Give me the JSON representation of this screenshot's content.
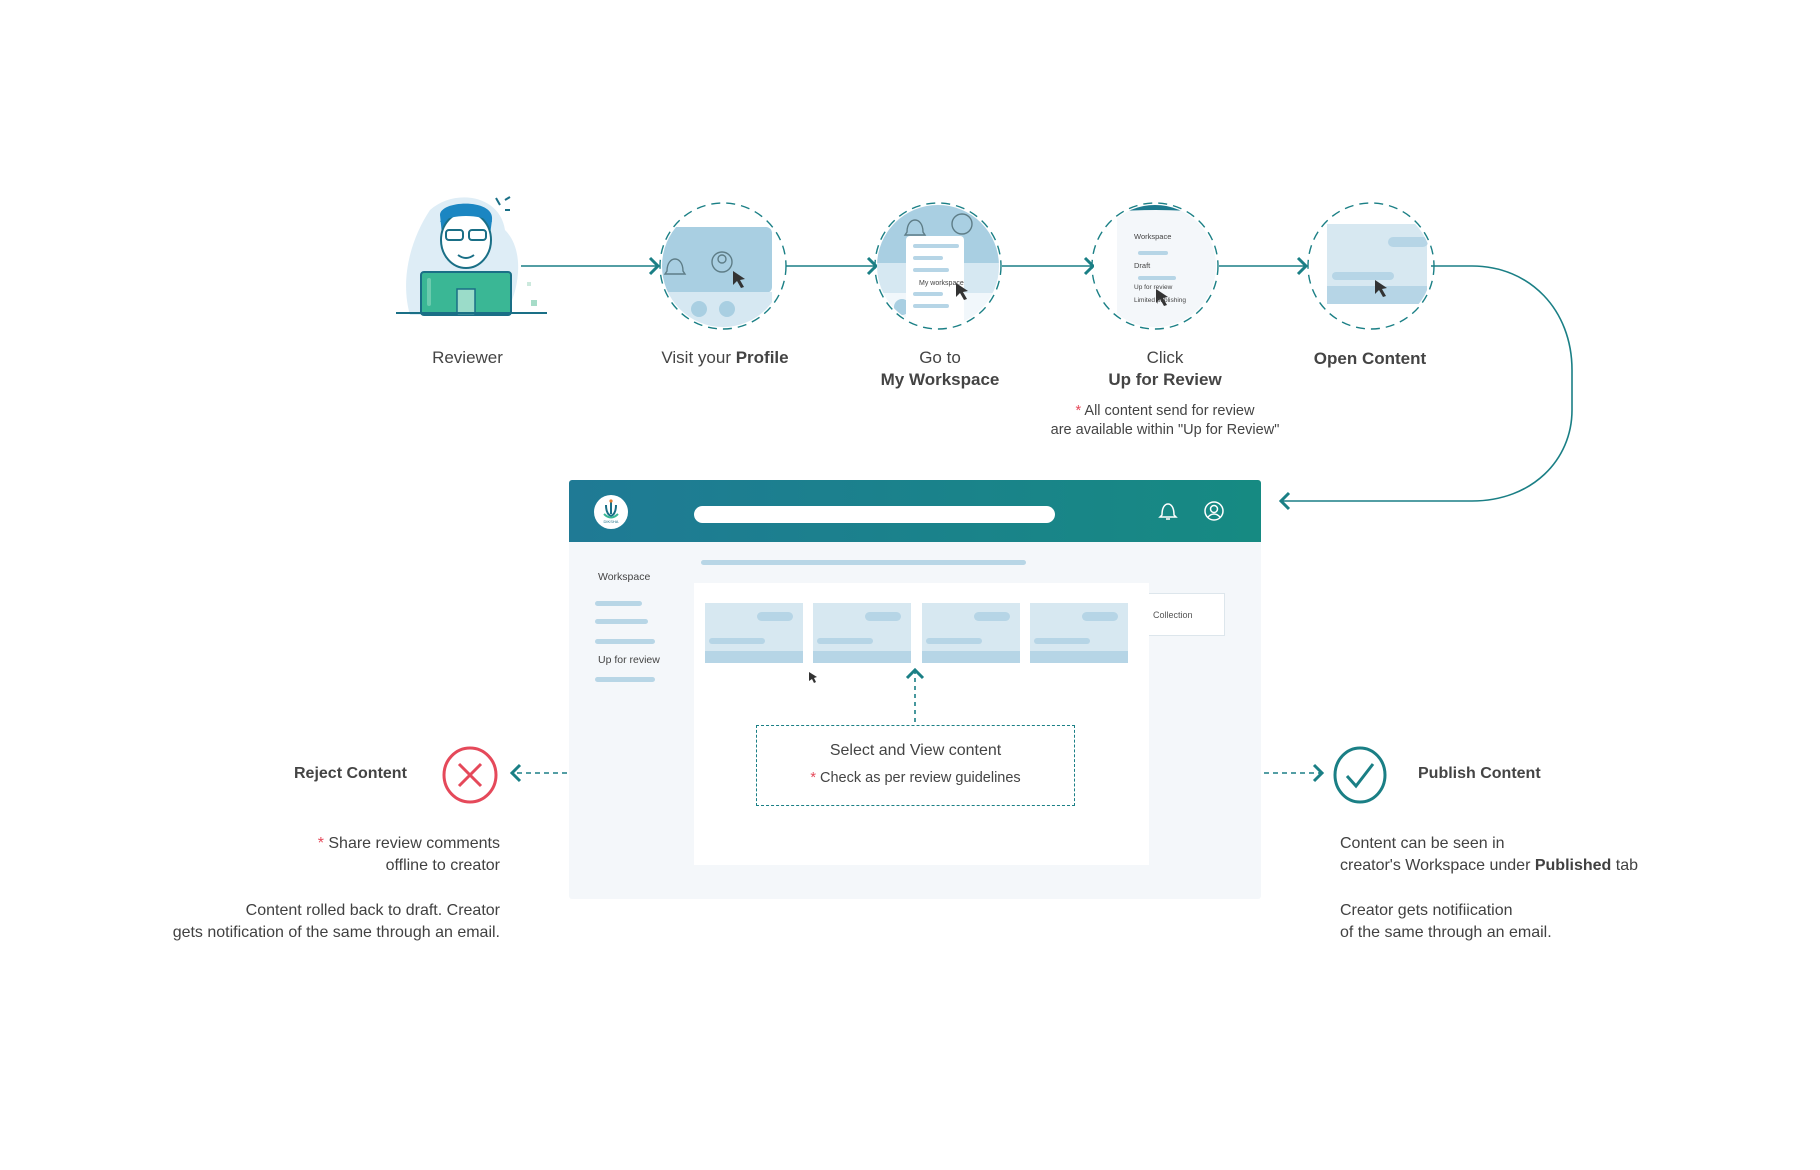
{
  "steps": [
    {
      "id": "reviewer",
      "label_plain": "Reviewer",
      "label_bold": ""
    },
    {
      "id": "profile",
      "label_plain": "Visit your ",
      "label_bold": "Profile"
    },
    {
      "id": "workspace",
      "label_plain": "Go to",
      "label_bold": "My Workspace"
    },
    {
      "id": "review",
      "label_plain": "Click",
      "label_bold": "Up for Review"
    },
    {
      "id": "open",
      "label_plain": "",
      "label_bold": "Open Content"
    }
  ],
  "review_note": {
    "star": "*",
    "line1": " All content send for review",
    "line2": "are available within \"Up for Review\""
  },
  "mini_workspace_menu": {
    "item1": "My workspace"
  },
  "mini_review_menu": {
    "title": "Workspace",
    "draft": "Draft",
    "up": "Up for review",
    "limited": "Limited publishing"
  },
  "window": {
    "logo_text": "DIKSHA",
    "sidebar_title": "Workspace",
    "sidebar_active": "Up for review",
    "collection_label": "Collection"
  },
  "center_box": {
    "title": "Select and View content",
    "star": "*",
    "note": " Check as per review guidelines"
  },
  "reject": {
    "title": "Reject Content",
    "star": "*",
    "note1a": " Share review comments",
    "note1b": "offline to creator",
    "note2a": "Content rolled back to draft. Creator",
    "note2b": "gets notification of the same through an email."
  },
  "publish": {
    "title": "Publish Content",
    "note1a": "Content can be seen in",
    "note1b_pre": "creator's Workspace under ",
    "note1b_bold": "Published",
    "note1b_post": " tab",
    "note2a": "Creator gets notifiication",
    "note2b": "of the same through an email."
  },
  "colors": {
    "teal": "#1a7f85",
    "reject": "#e5495a",
    "light_blue": "#b6d5e6",
    "text": "#444444"
  }
}
